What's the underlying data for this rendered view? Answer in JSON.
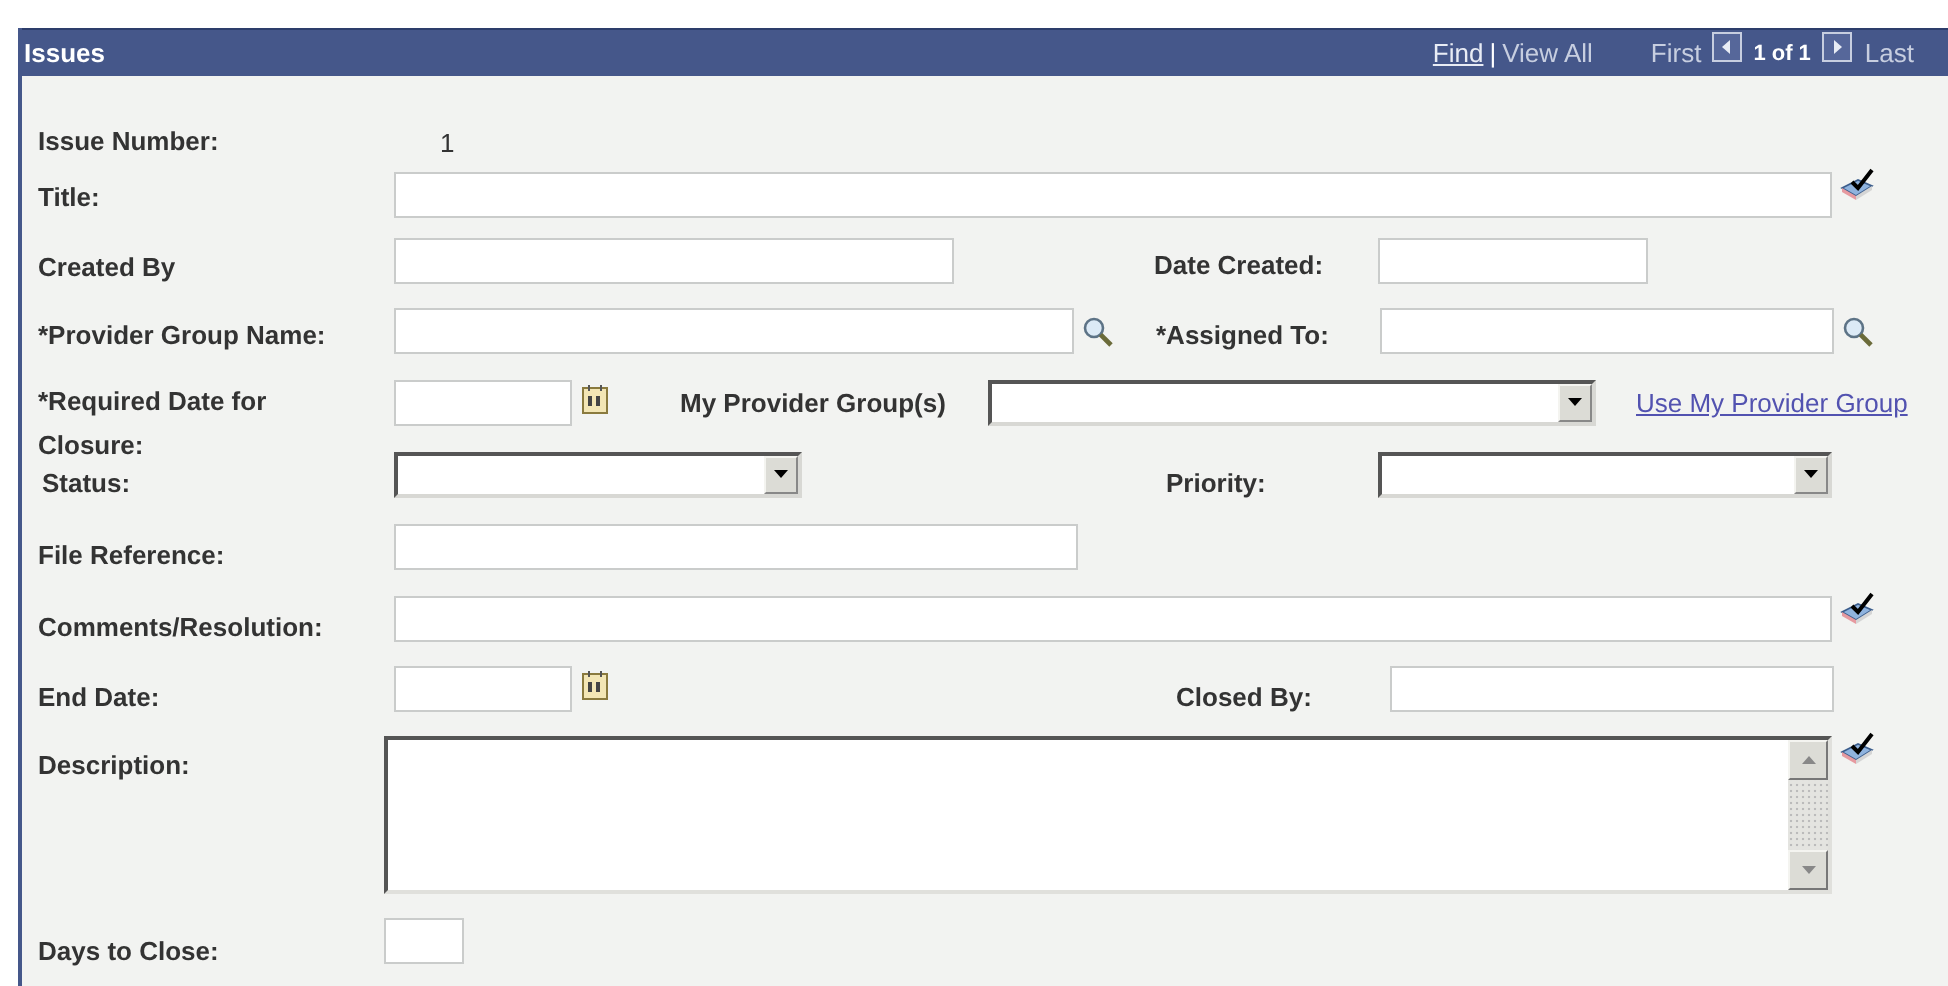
{
  "panel": {
    "title": "Issues",
    "find_link": "Find",
    "separator": "|",
    "view_all": "View All",
    "first": "First",
    "counter": "1 of 1",
    "last": "Last"
  },
  "form": {
    "issue_number": {
      "label": "Issue Number:",
      "value": "1"
    },
    "title": {
      "label": "Title:"
    },
    "created_by": {
      "label": "Created By"
    },
    "date_created": {
      "label": "Date Created:"
    },
    "provider_group_name": {
      "label": "*Provider Group Name:"
    },
    "assigned_to": {
      "label": "*Assigned To:"
    },
    "required_date": {
      "label": "*Required Date for Closure:"
    },
    "my_provider_groups": {
      "label": "My Provider Group(s)"
    },
    "use_my_provider_group": {
      "text": "Use My Provider Group"
    },
    "status": {
      "label": "Status:"
    },
    "priority": {
      "label": "Priority:"
    },
    "file_reference": {
      "label": "File Reference:"
    },
    "comments": {
      "label": "Comments/Resolution:"
    },
    "end_date": {
      "label": "End Date:"
    },
    "closed_by": {
      "label": "Closed By:"
    },
    "description": {
      "label": "Description:"
    },
    "days_to_close": {
      "label": "Days to Close:"
    }
  }
}
